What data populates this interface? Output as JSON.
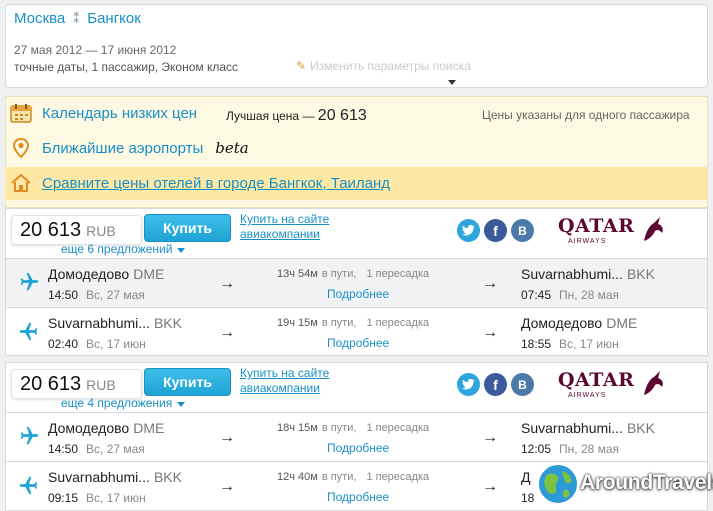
{
  "header": {
    "origin": "Москва",
    "destination": "Бангкок",
    "dates": "27 мая 2012  — 17 июня 2012",
    "params": "точные даты,  1 пассажир,  Эконом класс",
    "edit_label": "Изменить параметры поиска"
  },
  "tools": {
    "calendar_label": "Календарь низких цен",
    "best_price_label": "Лучшая цена —",
    "best_price_value": "20 613",
    "price_note": "Цены указаны для одного пассажира",
    "airports_label": "Ближайшие аэропорты",
    "beta": "beta",
    "hotels_link": "Сравните цены отелей в городе Бангкок, Таиланд"
  },
  "tickets": [
    {
      "price": "20 613",
      "currency": "RUB",
      "buy_label": "Купить",
      "airline_link_1": "Купить на сайте",
      "airline_link_2": "авиакомпании",
      "more_offers": "еще 6 предложений",
      "airline_word": "QATAR",
      "airline_sub": "AIRWAYS",
      "segments": [
        {
          "from_city": "Домодедово",
          "from_code": "DME",
          "dep_time": "14:50",
          "dep_date": "Вс, 27 мая",
          "duration": "13ч 54м",
          "in_transit": "в пути,",
          "stops": "1 пересадка",
          "details": "Подробнее",
          "to_city": "Suvarnabhumi...",
          "to_code": "BKK",
          "arr_time": "07:45",
          "arr_date": "Пн, 28 мая"
        },
        {
          "from_city": "Suvarnabhumi...",
          "from_code": "BKK",
          "dep_time": "02:40",
          "dep_date": "Вс, 17 июн",
          "duration": "19ч 15м",
          "in_transit": "в пути,",
          "stops": "1 пересадка",
          "details": "Подробнее",
          "to_city": "Домодедово",
          "to_code": "DME",
          "arr_time": "18:55",
          "arr_date": "Вс, 17 июн"
        }
      ]
    },
    {
      "price": "20 613",
      "currency": "RUB",
      "buy_label": "Купить",
      "airline_link_1": "Купить на сайте",
      "airline_link_2": "авиакомпании",
      "more_offers": "еще 4 предложения",
      "airline_word": "QATAR",
      "airline_sub": "AIRWAYS",
      "segments": [
        {
          "from_city": "Домодедово",
          "from_code": "DME",
          "dep_time": "14:50",
          "dep_date": "Вс, 27 мая",
          "duration": "18ч 15м",
          "in_transit": "в пути,",
          "stops": "1 пересадка",
          "details": "Подробнее",
          "to_city": "Suvarnabhumi...",
          "to_code": "BKK",
          "arr_time": "12:05",
          "arr_date": "Пн, 28 мая"
        },
        {
          "from_city": "Suvarnabhumi...",
          "from_code": "BKK",
          "dep_time": "09:15",
          "dep_date": "Вс, 17 июн",
          "duration": "12ч 40м",
          "in_transit": "в пути,",
          "stops": "1 пересадка",
          "details": "Подробнее",
          "to_city": "Д",
          "to_code": "",
          "arr_time": "18",
          "arr_date": ""
        }
      ]
    }
  ],
  "brand": {
    "name": "AroundTravels"
  },
  "colors": {
    "link": "#1a8fc6",
    "buy_button": "#1ea4d6",
    "tools_bg": "#fdf9e2",
    "hotel_bar": "#fde8a5",
    "qatar": "#5c0632"
  }
}
